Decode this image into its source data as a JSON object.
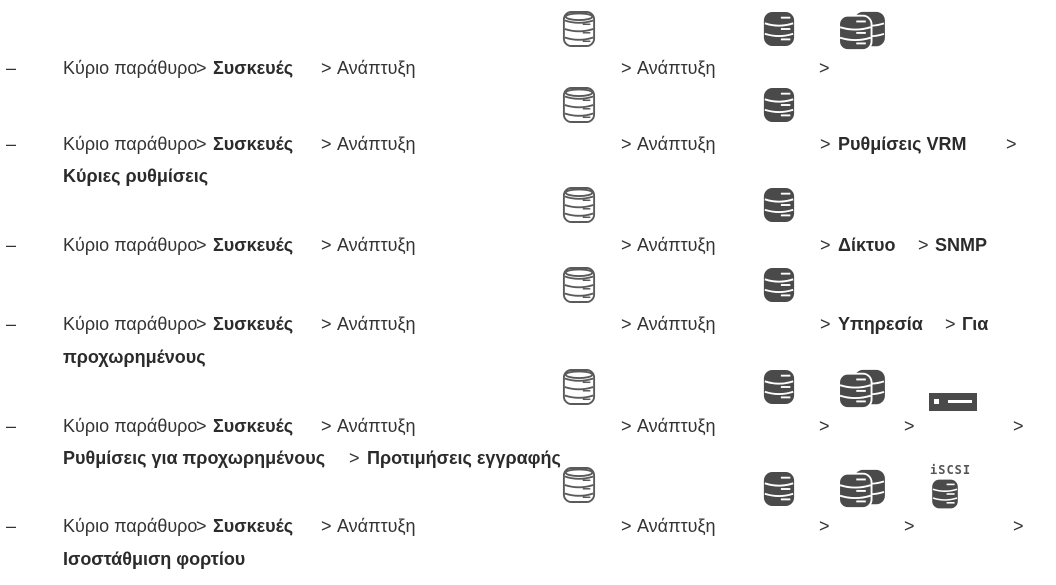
{
  "doc": {
    "dash": "–",
    "main_window": "Κύριο παράθυρο",
    "sep": ">",
    "devices": "Συσκευές",
    "expand": "Ανάπτυξη",
    "vrm_settings": "Ρυθμίσεις VRM",
    "main_settings": "Κύριες ρυθμίσεις",
    "network": "Δίκτυο",
    "snmp": "SNMP",
    "service": "Υπηρεσία",
    "for": "Για",
    "advanced": "προχωρημένους",
    "advanced_settings": "Ρυθμίσεις για προχωρημένους",
    "recording_prefs": "Προτιμήσεις εγγραφής",
    "load_balancing": "Ισοστάθμιση φορτίου",
    "iscsi_label": "iSCSI"
  },
  "icons": [
    "vrm-outline-server-icon",
    "vrm-server-icon",
    "pool-server-icon",
    "storage-device-icon",
    "iscsi-device-icon"
  ],
  "colors": {
    "text": "#333333",
    "icon_dark": "#4a4a4a",
    "icon_outline": "#6b6b6b"
  }
}
